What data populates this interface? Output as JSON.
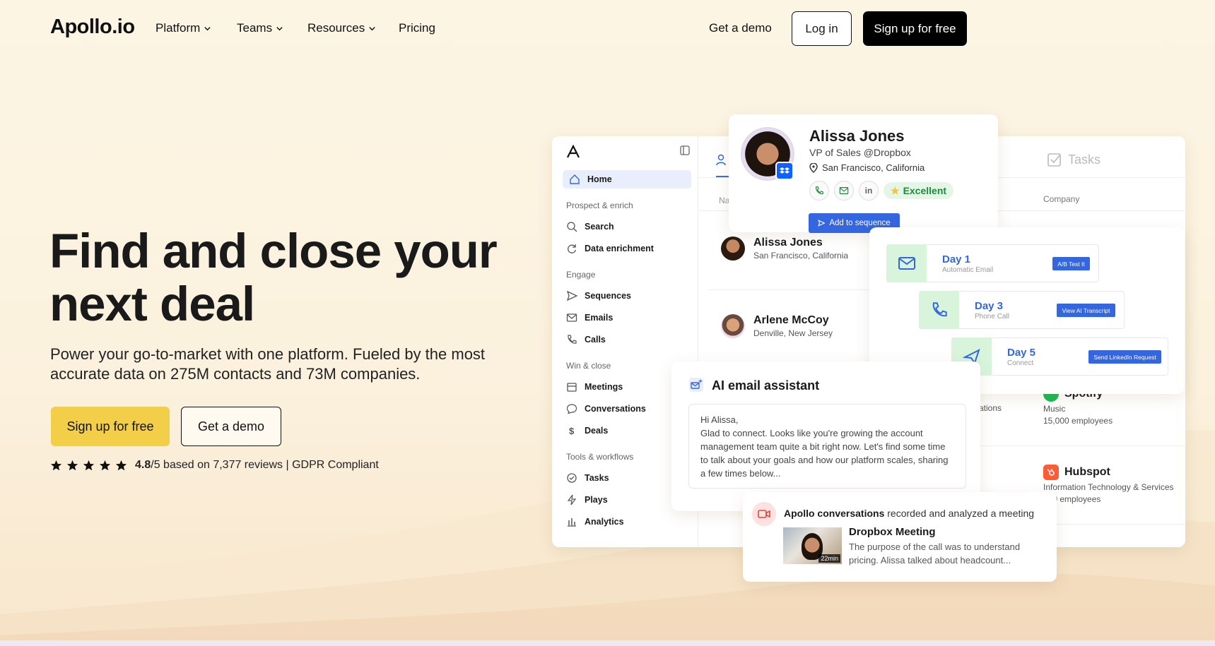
{
  "nav": {
    "logo": "Apollo.io",
    "links": [
      "Platform",
      "Teams",
      "Resources",
      "Pricing"
    ],
    "get_demo": "Get a demo",
    "login": "Log in",
    "signup": "Sign up for free"
  },
  "hero": {
    "title_line1": "Find and close your",
    "title_line2": "next deal",
    "subtitle": "Power your go-to-market with one platform. Fueled by the most accurate data on 275M contacts and 73M companies.",
    "signup": "Sign up for free",
    "get_demo": "Get a demo",
    "rating_value": "4.8",
    "rating_rest": "/5 based on 7,377 reviews | GDPR Compliant",
    "stars": 5
  },
  "app": {
    "sidebar": {
      "home": "Home",
      "sections": [
        {
          "label": "Prospect & enrich",
          "items": [
            "Search",
            "Data enrichment"
          ]
        },
        {
          "label": "Engage",
          "items": [
            "Sequences",
            "Emails",
            "Calls"
          ]
        },
        {
          "label": "Win & close",
          "items": [
            "Meetings",
            "Conversations",
            "Deals"
          ]
        },
        {
          "label": "Tools & workflows",
          "items": [
            "Tasks",
            "Plays",
            "Analytics"
          ]
        }
      ]
    },
    "tasks_tab": "Tasks",
    "col_company": "Company",
    "col_name": "Na",
    "contacts": [
      {
        "name": "Alissa Jones",
        "loc": "San Francisco, California"
      },
      {
        "name": "Arlene McCoy",
        "loc": "Denville, New Jersey"
      }
    ],
    "companies": [
      {
        "name": "Spotify",
        "industry": "Music",
        "size": "15,000 employees",
        "partial_industry": "ations"
      },
      {
        "name": "Hubspot",
        "industry": "Information Technology & Services",
        "size": "500 employees"
      }
    ]
  },
  "profile": {
    "name": "Alissa Jones",
    "title": "VP of Sales @Dropbox",
    "location": "San Francisco, California",
    "badge": "Excellent",
    "add_to_sequence": "Add to sequence",
    "linkedin": "in"
  },
  "sequence": {
    "days": [
      {
        "title": "Day 1",
        "sub": "Automatic Email",
        "button": "A/B Test It"
      },
      {
        "title": "Day 3",
        "sub": "Phone Call",
        "button": "View AI Transcript"
      },
      {
        "title": "Day 5",
        "sub": "Connect",
        "button": "Send LinkedIn Request"
      }
    ]
  },
  "ai_email": {
    "title": "AI email assistant",
    "greeting": "Hi Alissa,",
    "body": "Glad to connect. Looks like you're growing the account management team quite a bit right now. Let's find some time to talk about your goals and how our platform scales, sharing a few times below..."
  },
  "conversation": {
    "head_bold": "Apollo conversations",
    "head_rest": " recorded and analyzed a meeting",
    "title": "Dropbox Meeting",
    "body": "The purpose of the call was to understand pricing. Alissa talked about headcount...",
    "duration": "22min"
  },
  "colors": {
    "background": "#fdf6e6",
    "accent_yellow": "#f3ce49",
    "accent_blue": "#3466e0",
    "excellent_green": "#1d8a3d"
  }
}
